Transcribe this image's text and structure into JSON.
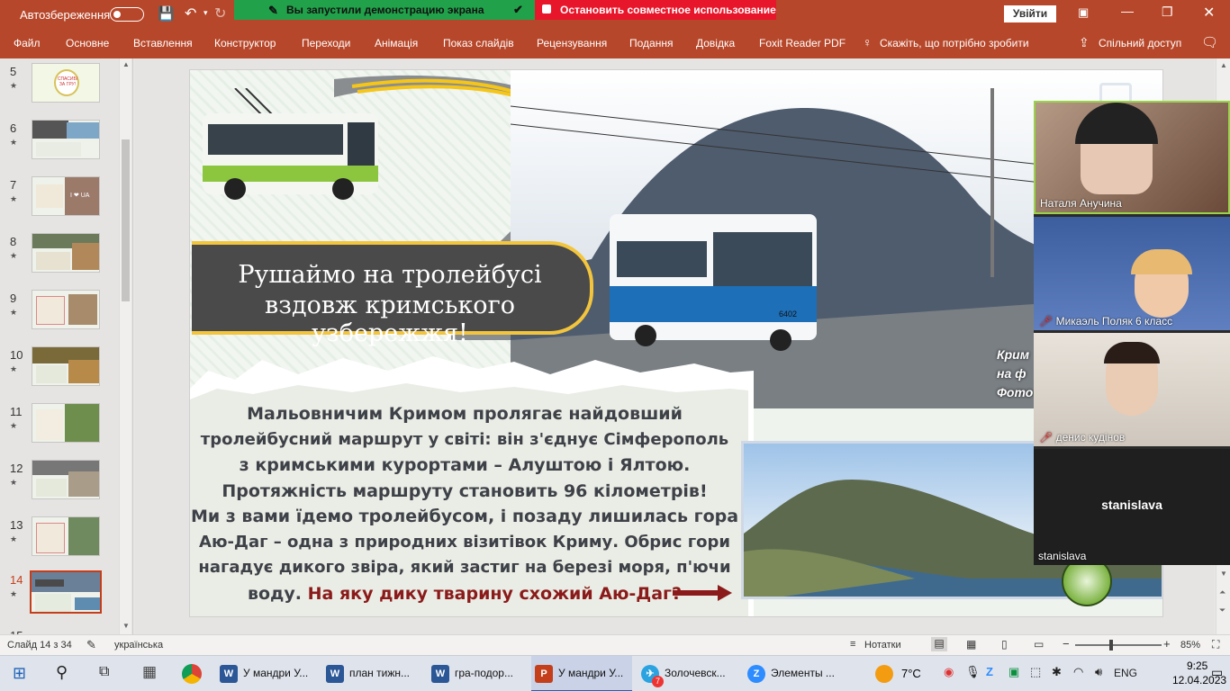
{
  "titlebar": {
    "autosave_label": "Автозбереження",
    "autosave_state": "Вимк.",
    "sign_in": "Увійти"
  },
  "share_banner": {
    "status": "Вы запустили демонстрацию экрана",
    "stop": "Остановить совместное использование"
  },
  "menu": {
    "items": [
      "Файл",
      "Основне",
      "Вставлення",
      "Конструктор",
      "Переходи",
      "Анімація",
      "Показ слайдів",
      "Рецензування",
      "Подання",
      "Довідка",
      "Foxit Reader PDF"
    ],
    "tell_me": "Скажіть, що потрібно зробити",
    "share": "Спільний доступ"
  },
  "thumbnails": [
    {
      "num": "5",
      "star": "★",
      "caption": "СПАСИБІ ЗА ГРУ!"
    },
    {
      "num": "6",
      "star": "★"
    },
    {
      "num": "7",
      "star": "★",
      "caption": "I ❤ UA"
    },
    {
      "num": "8",
      "star": "★"
    },
    {
      "num": "9",
      "star": "★"
    },
    {
      "num": "10",
      "star": "★"
    },
    {
      "num": "11",
      "star": "★"
    },
    {
      "num": "12",
      "star": "★"
    },
    {
      "num": "13",
      "star": "★"
    },
    {
      "num": "14",
      "star": "★"
    },
    {
      "num": "15",
      "star": ""
    }
  ],
  "selected_slide": "14",
  "slide": {
    "title_line1": "Рушаймо на тролейбусі",
    "title_line2": "вздовж кримського узбережжя!",
    "bus_number": "6402",
    "side_caption_1": "Крим",
    "side_caption_2": "на ф",
    "side_caption_3": "Фото",
    "body_lines": [
      "Мальовничим Кримом пролягає найдовший",
      "тролейбусний маршрут у світі: він з'єднує Сімферополь",
      "з кримськими курортами – Алуштою і Ялтою.",
      "Протяжність маршруту становить 96 кілометрів!",
      "Ми з вами їдемо тролейбусом, і позаду лишилась гора",
      "Аю-Даг – одна з природних візитівок Криму. Обрис гори",
      "нагадує дикого звіра, який застиг на березі моря, п'ючи"
    ],
    "last_line_plain": "воду.",
    "question": "На яку дику тварину схожий Аю-Даг?"
  },
  "participants": [
    {
      "name": "Наталя Анучина",
      "muted": false
    },
    {
      "name": "Микаэль Поляк 6 класс",
      "muted": true
    },
    {
      "name": "денис кудінов",
      "muted": true
    },
    {
      "name": "stanislava",
      "muted": false,
      "video": false
    }
  ],
  "status": {
    "slide_of": "Слайд 14 з 34",
    "language": "українська",
    "notes": "Нотатки",
    "zoom": "85%",
    "zoom_level": 0.85
  },
  "taskbar": {
    "apps": [
      {
        "label": "У мандри У...",
        "icon": "W",
        "color": "#2b5797"
      },
      {
        "label": "план тижн...",
        "icon": "W",
        "color": "#2b5797"
      },
      {
        "label": "гра-подор...",
        "icon": "W",
        "color": "#2b5797"
      },
      {
        "label": "У мандри У...",
        "icon": "P",
        "color": "#c43e1c"
      },
      {
        "label": "Золочевск...",
        "icon": "✈",
        "color": "#2aa3e0",
        "badge": "7"
      },
      {
        "label": "Элементы ...",
        "icon": "Z",
        "color": "#2d8cff"
      }
    ],
    "weather": "7°C",
    "lang": "ENG",
    "time": "9:25",
    "date": "12.04.2023"
  },
  "colors": {
    "accent": "#b7472a",
    "share_green": "#21a24a",
    "share_red": "#e8162a",
    "question": "#8b1a1a",
    "title_box": "#4a4a4a",
    "title_border": "#f3c53d"
  }
}
